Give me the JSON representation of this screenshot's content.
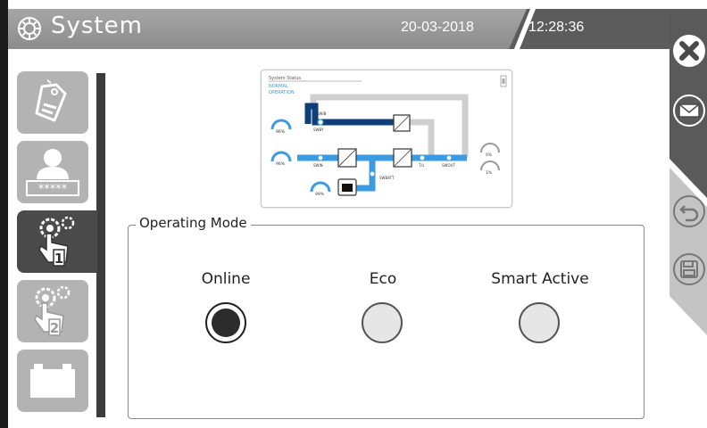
{
  "header": {
    "title": "System",
    "date": "20-03-2018",
    "time": "12:28:36",
    "settings_icon": "gear-icon"
  },
  "right_panel": {
    "buttons": [
      {
        "name": "close",
        "icon": "close-icon"
      },
      {
        "name": "messages",
        "icon": "envelope-icon"
      },
      {
        "name": "undo",
        "icon": "undo-icon"
      },
      {
        "name": "save",
        "icon": "floppy-icon"
      }
    ]
  },
  "sidebar": {
    "items": [
      {
        "name": "tags",
        "icon": "tag-icon",
        "active": false
      },
      {
        "name": "user-login",
        "icon": "user-password-icon",
        "password_mask": "*****",
        "active": false
      },
      {
        "name": "settings-1",
        "icon": "gear-hand-1-icon",
        "badge": "1",
        "active": true
      },
      {
        "name": "settings-2",
        "icon": "gear-hand-2-icon",
        "badge": "2",
        "active": false
      },
      {
        "name": "battery",
        "icon": "battery-icon",
        "active": false
      }
    ]
  },
  "diagram": {
    "status_title": "System Status",
    "status_line1": "NORMAL",
    "status_line2": "OPERATION",
    "labels": {
      "sw_bypass_in": "SWIB",
      "sw_bypass": "SWBY",
      "sw_in": "SWIN",
      "sw_bat": "SWBATT",
      "t_u": "T.U",
      "sw_out": "SWOUT"
    },
    "gauges": {
      "bypass_in": "96%",
      "input": "96%",
      "battery": "99%",
      "out_top": "0%",
      "out_bottom": "1%"
    }
  },
  "operating_mode": {
    "legend": "Operating Mode",
    "options": [
      {
        "label": "Online",
        "selected": true
      },
      {
        "label": "Eco",
        "selected": false
      },
      {
        "label": "Smart Active",
        "selected": false
      }
    ]
  },
  "colors": {
    "header_grey": "#999999",
    "dark": "#3c3c3c",
    "accent_blue": "#3a9be0",
    "dark_blue": "#0f3f78"
  }
}
